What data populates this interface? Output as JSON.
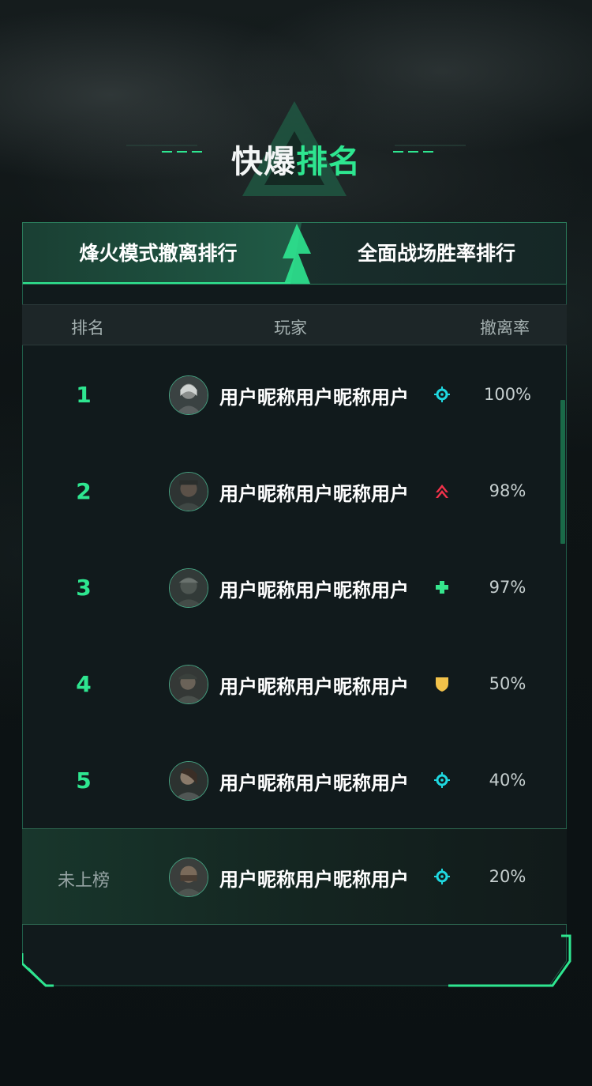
{
  "title": {
    "white": "快爆",
    "green": "排名"
  },
  "tabs": [
    {
      "label": "烽火模式撤离排行",
      "active": true
    },
    {
      "label": "全面战场胜率排行",
      "active": false
    }
  ],
  "table_header": {
    "rank": "排名",
    "player": "玩家",
    "rate": "撤离率"
  },
  "rows": [
    {
      "rank": "1",
      "name": "用户昵称用户昵称用户",
      "badge": "crosshair-icon",
      "rate": "100%"
    },
    {
      "rank": "2",
      "name": "用户昵称用户昵称用户",
      "badge": "chevron-up-icon",
      "rate": "98%"
    },
    {
      "rank": "3",
      "name": "用户昵称用户昵称用户",
      "badge": "plus-icon",
      "rate": "97%"
    },
    {
      "rank": "4",
      "name": "用户昵称用户昵称用户",
      "badge": "shield-icon",
      "rate": "50%"
    },
    {
      "rank": "5",
      "name": "用户昵称用户昵称用户",
      "badge": "crosshair-icon",
      "rate": "40%"
    }
  ],
  "self_row": {
    "rank": "未上榜",
    "name": "用户昵称用户昵称用户",
    "badge": "crosshair-icon",
    "rate": "20%"
  },
  "colors": {
    "accent_green": "#2ee690",
    "badge_cyan": "#1fd8e0",
    "badge_red": "#f2324a",
    "badge_green": "#36e58d",
    "badge_yellow": "#f2c24a"
  }
}
